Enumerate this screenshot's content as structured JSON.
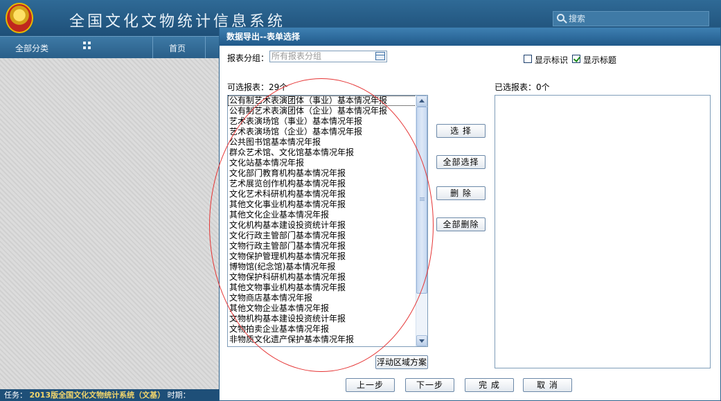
{
  "app": {
    "title": "全国文化文物统计信息系统",
    "search_placeholder": "搜索",
    "nav": {
      "all_categories": "全部分类",
      "home": "首页"
    },
    "status": {
      "prefix": "任务：",
      "task": "2013版全国文化文物统计系统（文基）",
      "suffix": "时期："
    }
  },
  "dialog": {
    "title": "数据导出--表单选择",
    "group_label": "报表分组：",
    "group_placeholder": "所有报表分组",
    "show_id_label": "显示标识",
    "show_title_label": "显示标题",
    "show_id_checked": false,
    "show_title_checked": true,
    "available_label": "可选报表：29个",
    "selected_label": "已选报表：0个",
    "available_items": [
      "公有制艺术表演团体（事业）基本情况年报",
      "公有制艺术表演团体（企业）基本情况年报",
      "艺术表演场馆（事业）基本情况年报",
      "艺术表演场馆（企业）基本情况年报",
      "公共图书馆基本情况年报",
      "群众艺术馆、文化馆基本情况年报",
      "文化站基本情况年报",
      "文化部门教育机构基本情况年报",
      "艺术展览创作机构基本情况年报",
      "文化艺术科研机构基本情况年报",
      "其他文化事业机构基本情况年报",
      "其他文化企业基本情况年报",
      "文化机构基本建设投资统计年报",
      "文化行政主管部门基本情况年报",
      "文物行政主管部门基本情况年报",
      "文物保护管理机构基本情况年报",
      "博物馆(纪念馆)基本情况年报",
      "文物保护科研机构基本情况年报",
      "其他文物事业机构基本情况年报",
      "文物商店基本情况年报",
      "其他文物企业基本情况年报",
      "文物机构基本建设投资统计年报",
      "文物拍卖企业基本情况年报",
      "非物质文化遗产保护基本情况年报"
    ],
    "buttons": {
      "select": "选 择",
      "select_all": "全部选择",
      "delete": "删 除",
      "delete_all": "全部删除",
      "float_scheme": "浮动区域方案",
      "prev": "上一步",
      "next": "下一步",
      "finish": "完 成",
      "cancel": "取 消"
    }
  },
  "colors": {
    "header": "#1e4f78",
    "dialog_title": "#20598a",
    "annotation": "#e53333"
  }
}
